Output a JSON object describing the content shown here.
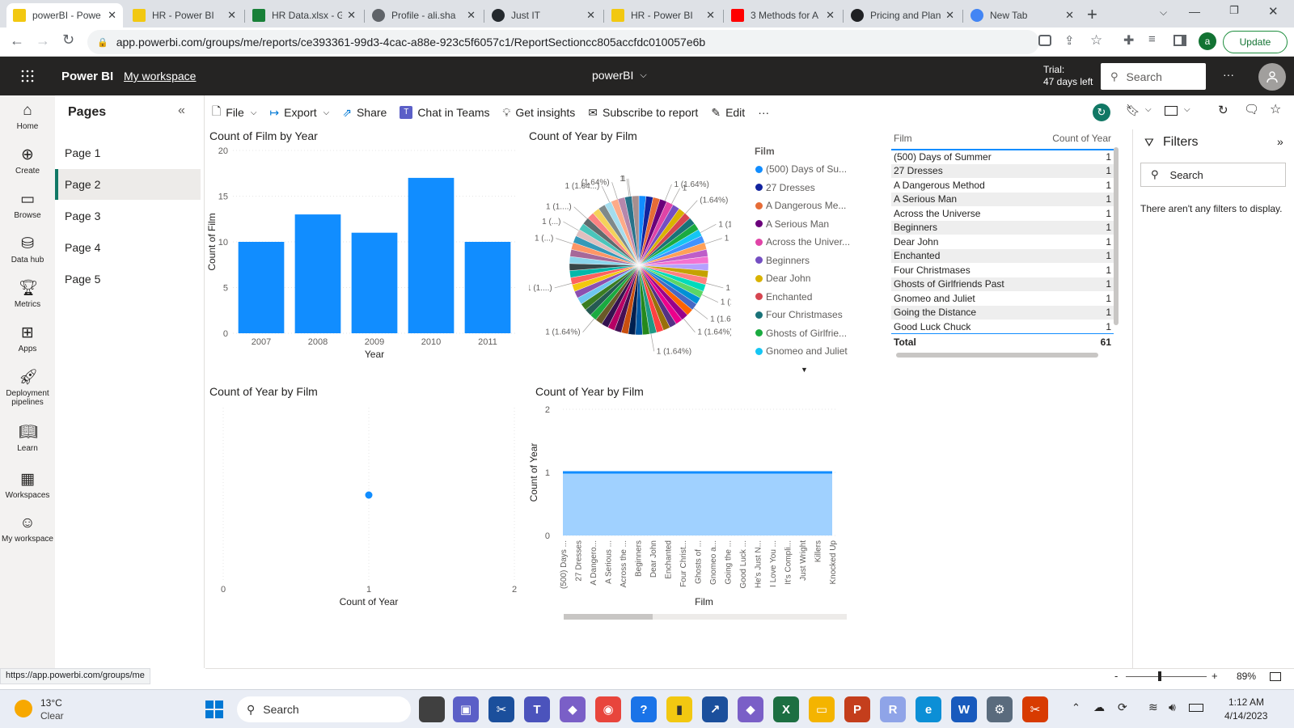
{
  "browser": {
    "tabs": [
      {
        "label": "powerBI - Powe",
        "icon": "powerbi-icon",
        "active": true
      },
      {
        "label": "HR - Power BI",
        "icon": "powerbi-icon",
        "active": false
      },
      {
        "label": "HR Data.xlsx - G",
        "icon": "sheets-icon",
        "active": false
      },
      {
        "label": "Profile - ali.sha",
        "icon": "gear-icon",
        "active": false
      },
      {
        "label": "Just IT",
        "icon": "github-icon",
        "active": false
      },
      {
        "label": "HR - Power BI",
        "icon": "powerbi-icon",
        "active": false
      },
      {
        "label": "3 Methods for A",
        "icon": "youtube-icon",
        "active": false
      },
      {
        "label": "Pricing and Plan",
        "icon": "openai-icon",
        "active": false
      },
      {
        "label": "New Tab",
        "icon": "chrome-icon",
        "active": false
      }
    ],
    "url": "app.powerbi.com/groups/me/reports/ce393361-99d3-4cac-a88e-923c5f6057c1/ReportSectioncc805accfdc010057e6b",
    "update_label": "Update",
    "profile_initial": "a",
    "status_url": "https://app.powerbi.com/groups/me"
  },
  "header": {
    "app_name": "Power BI",
    "workspace": "My workspace",
    "report_name": "powerBI",
    "trial_line1": "Trial:",
    "trial_line2": "47 days left",
    "search_placeholder": "Search",
    "more": "···"
  },
  "leftnav": [
    {
      "label": "Home",
      "icon": "home-icon"
    },
    {
      "label": "Create",
      "icon": "create-icon"
    },
    {
      "label": "Browse",
      "icon": "browse-icon"
    },
    {
      "label": "Data hub",
      "icon": "datahub-icon"
    },
    {
      "label": "Metrics",
      "icon": "metrics-icon"
    },
    {
      "label": "Apps",
      "icon": "apps-icon"
    },
    {
      "label": "Deployment pipelines",
      "icon": "rocket-icon"
    },
    {
      "label": "Learn",
      "icon": "book-icon"
    },
    {
      "label": "Workspaces",
      "icon": "workspaces-icon"
    },
    {
      "label": "My workspace",
      "icon": "person-icon"
    }
  ],
  "pages": {
    "title": "Pages",
    "items": [
      "Page 1",
      "Page 2",
      "Page 3",
      "Page 4",
      "Page 5"
    ],
    "active_index": 1
  },
  "toolbar": {
    "file": "File",
    "export": "Export",
    "share": "Share",
    "chat": "Chat in Teams",
    "insights": "Get insights",
    "subscribe": "Subscribe to report",
    "edit": "Edit",
    "more": "···"
  },
  "filters": {
    "title": "Filters",
    "search_placeholder": "Search",
    "empty_text": "There aren't any filters to display."
  },
  "zoom": {
    "level": "89%",
    "minus": "-",
    "plus": "+"
  },
  "taskbar": {
    "weather_temp": "13°C",
    "weather_desc": "Clear",
    "search_placeholder": "Search",
    "time": "1:12 AM",
    "date": "4/14/2023"
  },
  "chart_data": [
    {
      "id": "bar",
      "type": "bar",
      "title": "Count of Film by Year",
      "xlabel": "Year",
      "ylabel": "Count of Film",
      "categories": [
        "2007",
        "2008",
        "2009",
        "2010",
        "2011"
      ],
      "values": [
        10,
        13,
        11,
        17,
        10
      ],
      "ylim": [
        0,
        20
      ],
      "yticks": [
        "0",
        "5",
        "10",
        "15",
        "20"
      ],
      "color": "#118dff"
    },
    {
      "id": "pie",
      "type": "pie",
      "title": "Count of Year by Film",
      "legend_title": "Film",
      "legend": [
        {
          "label": "(500) Days of Su...",
          "color": "#118dff"
        },
        {
          "label": "27 Dresses",
          "color": "#12239e"
        },
        {
          "label": "A Dangerous Me...",
          "color": "#e66c37"
        },
        {
          "label": "A Serious Man",
          "color": "#6b007b"
        },
        {
          "label": "Across the Univer...",
          "color": "#e044a7"
        },
        {
          "label": "Beginners",
          "color": "#744ec2"
        },
        {
          "label": "Dear John",
          "color": "#d9b300"
        },
        {
          "label": "Enchanted",
          "color": "#d64550"
        },
        {
          "label": "Four Christmases",
          "color": "#197278"
        },
        {
          "label": "Ghosts of Girlfrie...",
          "color": "#1aab40"
        },
        {
          "label": "Gnomeo and Juliet",
          "color": "#15c6f4"
        }
      ],
      "slice_count": 61,
      "slice_value": 1,
      "slice_colors": [
        "#118dff",
        "#12239e",
        "#e66c37",
        "#6b007b",
        "#e044a7",
        "#744ec2",
        "#d9b300",
        "#d64550",
        "#197278",
        "#1aab40",
        "#15c6f4",
        "#4092ff",
        "#ffa058",
        "#be5dc9",
        "#f472d0",
        "#b5a1ff",
        "#c4a200",
        "#ff8080",
        "#00dbbc",
        "#5bd667",
        "#0091d5",
        "#4668c5",
        "#ff6300",
        "#99008a",
        "#ec008c",
        "#533285",
        "#99700a",
        "#ff4141",
        "#1f9a85",
        "#25891c",
        "#0057a2",
        "#002050",
        "#c94f0f",
        "#450f54",
        "#b60064",
        "#34124f",
        "#6a5a29",
        "#1aab40",
        "#255a52",
        "#3a7d22",
        "#6ec6f0",
        "#8c4fb0",
        "#f2c80f",
        "#fd625e",
        "#01b8aa",
        "#374649",
        "#8ad4eb",
        "#a66999",
        "#fe9666",
        "#3599b8",
        "#dfbfbf",
        "#4ac5bb",
        "#5f6b6d",
        "#fb8281",
        "#f4d25a",
        "#7f898a",
        "#a4ddee",
        "#fdab89",
        "#b687ac",
        "#28738a",
        "#a78f8f"
      ],
      "data_labels": [
        "1",
        "1 (1.64%)",
        "1",
        "(1.64%)",
        "1 (1....)",
        "1 (...",
        "1 (...)",
        "1 (1....)",
        "1 (1.6...)",
        "1 (1.64%)",
        "1 (1.64%)",
        "1 (1.64%)",
        "1 (1....)",
        "1 (...)",
        "1 (...)",
        "1 (1....)",
        "1 (1.64...)",
        "(1.64%)",
        "1"
      ]
    },
    {
      "id": "table",
      "type": "table",
      "columns": [
        "Film",
        "Count of Year"
      ],
      "rows": [
        [
          "(500) Days of Summer",
          "1"
        ],
        [
          "27 Dresses",
          "1"
        ],
        [
          "A Dangerous Method",
          "1"
        ],
        [
          "A Serious Man",
          "1"
        ],
        [
          "Across the Universe",
          "1"
        ],
        [
          "Beginners",
          "1"
        ],
        [
          "Dear John",
          "1"
        ],
        [
          "Enchanted",
          "1"
        ],
        [
          "Four Christmases",
          "1"
        ],
        [
          "Ghosts of Girlfriends Past",
          "1"
        ],
        [
          "Gnomeo and Juliet",
          "1"
        ],
        [
          "Going the Distance",
          "1"
        ],
        [
          "Good Luck Chuck",
          "1"
        ]
      ],
      "total_label": "Total",
      "total_value": "61"
    },
    {
      "id": "scatter",
      "type": "scatter",
      "title": "Count of Year by Film",
      "xlabel": "Count of Year",
      "x": [
        1
      ],
      "y": [
        1
      ],
      "xlim": [
        0,
        2
      ],
      "xticks": [
        "0",
        "1",
        "2"
      ],
      "color": "#118dff"
    },
    {
      "id": "area",
      "type": "area",
      "title": "Count of Year by Film",
      "xlabel": "Film",
      "ylabel": "Count of Year",
      "categories": [
        "(500) Days ...",
        "27 Dresses",
        "A Dangero...",
        "A Serious ...",
        "Across the ...",
        "Beginners",
        "Dear John",
        "Enchanted",
        "Four Christ...",
        "Ghosts of ...",
        "Gnomeo a...",
        "Going the ...",
        "Good Luck ...",
        "He's Just N...",
        "I Love You ...",
        "It's Compli...",
        "Just Wright",
        "Killers",
        "Knocked Up"
      ],
      "values": [
        1,
        1,
        1,
        1,
        1,
        1,
        1,
        1,
        1,
        1,
        1,
        1,
        1,
        1,
        1,
        1,
        1,
        1,
        1
      ],
      "ylim": [
        0,
        2
      ],
      "yticks": [
        "0",
        "1",
        "2"
      ],
      "line_color": "#118dff",
      "fill_color": "#a0d1ff"
    }
  ]
}
